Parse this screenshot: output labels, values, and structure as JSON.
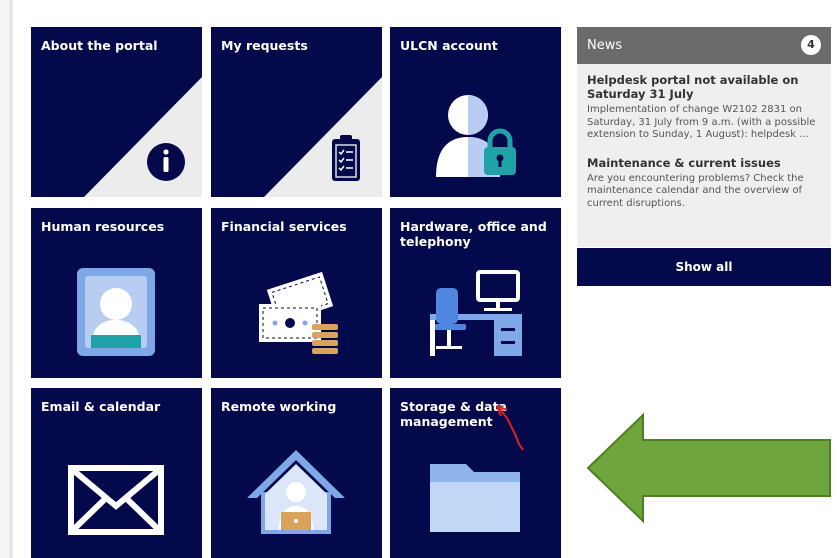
{
  "tiles": [
    {
      "title": "About the portal",
      "icon": "info-icon"
    },
    {
      "title": "My requests",
      "icon": "clipboard-checklist-icon"
    },
    {
      "title": "ULCN account",
      "icon": "user-lock-icon"
    },
    {
      "title": "Human resources",
      "icon": "id-badge-icon"
    },
    {
      "title": "Financial services",
      "icon": "money-stack-icon"
    },
    {
      "title": "Hardware, office and telephony",
      "icon": "office-desk-icon"
    },
    {
      "title": "Email & calendar",
      "icon": "envelope-icon"
    },
    {
      "title": "Remote working",
      "icon": "home-worker-icon"
    },
    {
      "title": "Storage & data management",
      "icon": "folder-icon"
    }
  ],
  "news": {
    "header": "News",
    "count": "4",
    "items": [
      {
        "title": "Helpdesk portal not available on Saturday 31 July",
        "body": "Implementation of change W2102 2831 on Saturday, 31 July from 9 a.m. (with a possible extension to Sunday, 1 August): helpdesk ..."
      },
      {
        "title": "Maintenance & current issues",
        "body": "Are you encountering problems? Check the maintenance calendar and the overview of current disruptions."
      }
    ],
    "show_all": "Show all"
  },
  "colors": {
    "tile_bg": "#04094b",
    "accent_light": "#ececec",
    "icon_blue": "#7fa8e8",
    "icon_teal": "#1fa3a8",
    "arrow_green": "#6ea53c",
    "annotation_red": "#e31d1d"
  }
}
